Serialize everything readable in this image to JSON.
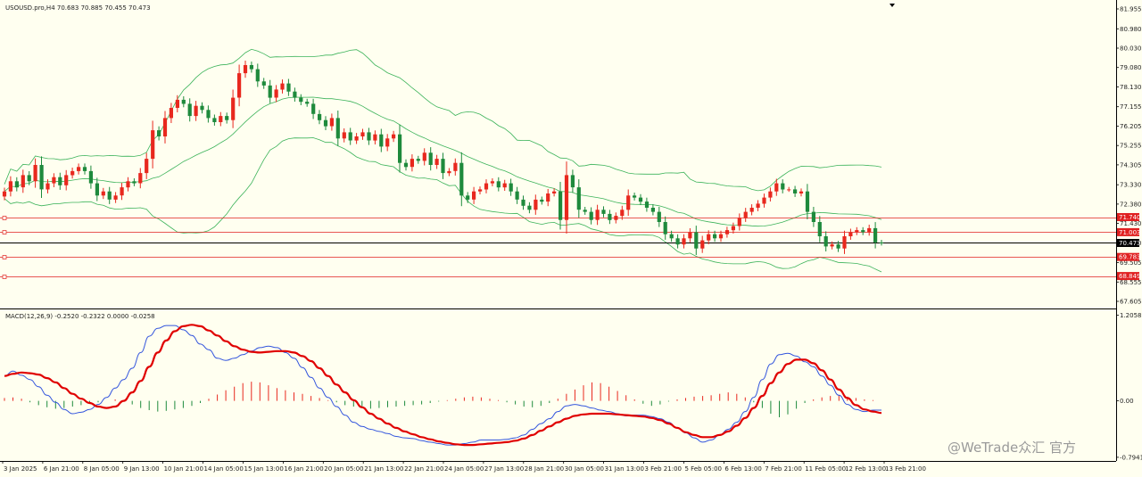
{
  "header": {
    "symbol_info": "USOUSD.pro,H4  70.683 70.885 70.455 70.473",
    "macd_info": "MACD(12,26,9) -0.2520 -0.2322 0.0000 -0.0258"
  },
  "watermark": "@WeTrade众汇 官方",
  "colors": {
    "background": "#fffff0",
    "bull": "#e8281e",
    "bear": "#1e8a3c",
    "bands": "#3cb35a",
    "macd_line": "#3355dd",
    "signal_line": "#e00000",
    "hline": "#e02020",
    "current_price": "#000000"
  },
  "chart_data": [
    {
      "type": "candlestick",
      "name": "price",
      "title": "USOUSD.pro,H4",
      "ylim": [
        67.3,
        82.0
      ],
      "y_ticks": [
        "81.955",
        "80.980",
        "80.030",
        "79.080",
        "78.130",
        "77.155",
        "76.205",
        "75.255",
        "74.305",
        "73.330",
        "72.380",
        "71.430",
        "70.480",
        "69.505",
        "68.555",
        "67.605"
      ],
      "x_ticks": [
        "3 Jan 2025",
        "6 Jan 21:00",
        "8 Jan 05:00",
        "9 Jan 13:00",
        "10 Jan 21:00",
        "14 Jan 05:00",
        "15 Jan 13:00",
        "16 Jan 21:00",
        "20 Jan 05:00",
        "21 Jan 13:00",
        "22 Jan 21:00",
        "24 Jan 05:00",
        "27 Jan 13:00",
        "28 Jan 21:00",
        "30 Jan 05:00",
        "31 Jan 13:00",
        "3 Feb 21:00",
        "5 Feb 05:00",
        "6 Feb 13:00",
        "7 Feb 21:00",
        "11 Feb 05:00",
        "12 Feb 13:00",
        "13 Feb 21:00"
      ],
      "close": [
        73.0,
        73.5,
        73.2,
        73.8,
        73.5,
        74.3,
        73.1,
        73.4,
        73.7,
        73.3,
        73.8,
        74.0,
        74.2,
        74.0,
        73.4,
        72.8,
        73.0,
        72.6,
        72.8,
        73.2,
        73.5,
        73.4,
        73.9,
        74.6,
        76.0,
        75.7,
        76.6,
        77.1,
        77.5,
        77.3,
        76.7,
        77.2,
        77.0,
        76.6,
        76.4,
        76.7,
        76.5,
        77.6,
        78.8,
        79.2,
        79.0,
        78.4,
        78.2,
        77.6,
        78.0,
        78.3,
        77.9,
        77.6,
        77.4,
        77.3,
        76.8,
        76.5,
        76.2,
        76.6,
        75.6,
        75.9,
        75.5,
        75.7,
        75.9,
        75.5,
        75.8,
        75.2,
        75.6,
        75.8,
        74.4,
        74.2,
        74.6,
        74.5,
        74.9,
        74.3,
        74.6,
        73.9,
        74.0,
        74.4,
        72.8,
        72.6,
        73.0,
        73.1,
        73.4,
        73.5,
        73.2,
        73.4,
        73.0,
        72.6,
        72.3,
        72.1,
        72.6,
        72.5,
        72.9,
        73.0,
        71.6,
        73.8,
        73.2,
        72.1,
        72.0,
        71.6,
        72.1,
        71.9,
        71.6,
        71.8,
        72.1,
        72.8,
        72.7,
        72.5,
        72.2,
        72.0,
        71.5,
        70.9,
        70.7,
        70.4,
        70.7,
        71.0,
        70.2,
        70.6,
        70.9,
        70.7,
        70.9,
        71.1,
        71.3,
        71.7,
        72.0,
        72.2,
        72.4,
        72.7,
        73.0,
        73.4,
        73.1,
        73.1,
        72.9,
        73.0,
        72.0,
        71.5,
        70.8,
        70.3,
        70.4,
        70.2,
        70.8,
        71.0,
        71.1,
        71.0,
        71.2,
        70.5,
        70.473
      ],
      "annotations": [
        {
          "text": "71.740",
          "value": 71.74
        },
        {
          "text": "71.003",
          "value": 71.003
        },
        {
          "text": "70.473",
          "value": 70.473
        },
        {
          "text": "69.783",
          "value": 69.783
        },
        {
          "text": "68.849",
          "value": 68.849
        }
      ]
    },
    {
      "type": "line",
      "name": "MACD",
      "title": "MACD(12,26,9)",
      "ylim": [
        -0.82,
        1.25
      ],
      "y_ticks": [
        "1.2058",
        "0.00",
        "-0.7941"
      ],
      "series": [
        {
          "name": "MACD",
          "values": [
            0.35,
            0.42,
            0.36,
            0.3,
            0.2,
            0.08,
            -0.02,
            -0.12,
            -0.18,
            -0.16,
            -0.12,
            -0.05,
            0.05,
            0.18,
            0.3,
            0.46,
            0.68,
            0.91,
            1.02,
            1.06,
            1.06,
            1.0,
            0.92,
            0.8,
            0.72,
            0.6,
            0.57,
            0.6,
            0.65,
            0.7,
            0.75,
            0.77,
            0.75,
            0.68,
            0.6,
            0.47,
            0.33,
            0.18,
            0.05,
            -0.08,
            -0.2,
            -0.3,
            -0.36,
            -0.4,
            -0.43,
            -0.46,
            -0.5,
            -0.52,
            -0.53,
            -0.56,
            -0.58,
            -0.6,
            -0.62,
            -0.62,
            -0.6,
            -0.58,
            -0.55,
            -0.55,
            -0.55,
            -0.54,
            -0.52,
            -0.48,
            -0.4,
            -0.32,
            -0.25,
            -0.15,
            -0.07,
            -0.05,
            -0.07,
            -0.1,
            -0.13,
            -0.15,
            -0.18,
            -0.21,
            -0.2,
            -0.2,
            -0.22,
            -0.25,
            -0.3,
            -0.38,
            -0.45,
            -0.52,
            -0.58,
            -0.55,
            -0.48,
            -0.4,
            -0.3,
            -0.15,
            0.05,
            0.3,
            0.52,
            0.65,
            0.67,
            0.63,
            0.55,
            0.48,
            0.35,
            0.22,
            0.08,
            -0.05,
            -0.12,
            -0.15,
            -0.13,
            -0.13
          ]
        },
        {
          "name": "Signal",
          "values": [
            0.35,
            0.38,
            0.4,
            0.39,
            0.37,
            0.32,
            0.26,
            0.18,
            0.1,
            0.03,
            -0.03,
            -0.08,
            -0.1,
            -0.08,
            0.0,
            0.12,
            0.28,
            0.48,
            0.68,
            0.85,
            0.98,
            1.05,
            1.07,
            1.05,
            0.99,
            0.92,
            0.84,
            0.77,
            0.72,
            0.69,
            0.68,
            0.69,
            0.7,
            0.7,
            0.68,
            0.63,
            0.56,
            0.46,
            0.35,
            0.23,
            0.12,
            0.01,
            -0.09,
            -0.18,
            -0.25,
            -0.32,
            -0.38,
            -0.43,
            -0.47,
            -0.51,
            -0.54,
            -0.57,
            -0.59,
            -0.61,
            -0.62,
            -0.62,
            -0.61,
            -0.6,
            -0.59,
            -0.58,
            -0.56,
            -0.53,
            -0.48,
            -0.42,
            -0.36,
            -0.3,
            -0.25,
            -0.21,
            -0.19,
            -0.18,
            -0.18,
            -0.18,
            -0.19,
            -0.2,
            -0.21,
            -0.22,
            -0.24,
            -0.27,
            -0.32,
            -0.38,
            -0.44,
            -0.48,
            -0.51,
            -0.51,
            -0.48,
            -0.43,
            -0.35,
            -0.24,
            -0.1,
            0.07,
            0.25,
            0.4,
            0.52,
            0.58,
            0.58,
            0.53,
            0.43,
            0.3,
            0.16,
            0.04,
            -0.06,
            -0.12,
            -0.15,
            -0.17
          ]
        },
        {
          "name": "Histogram",
          "values": [
            0.04,
            0.05,
            0.03,
            -0.02,
            -0.06,
            -0.09,
            -0.11,
            -0.1,
            -0.08,
            -0.06,
            -0.04,
            -0.02,
            0.0,
            0.02,
            -0.01,
            -0.05,
            -0.1,
            -0.13,
            -0.15,
            -0.14,
            -0.12,
            -0.1,
            -0.07,
            -0.03,
            0.03,
            0.09,
            0.15,
            0.2,
            0.25,
            0.27,
            0.26,
            0.22,
            0.18,
            0.15,
            0.12,
            0.1,
            0.07,
            0.04,
            0.01,
            -0.02,
            -0.06,
            -0.08,
            -0.1,
            -0.11,
            -0.1,
            -0.09,
            -0.08,
            -0.07,
            -0.06,
            -0.05,
            -0.03,
            -0.01,
            0.01,
            0.03,
            0.05,
            0.06,
            0.05,
            0.03,
            0.01,
            -0.02,
            -0.05,
            -0.08,
            -0.09,
            -0.07,
            -0.03,
            0.03,
            0.1,
            0.16,
            0.22,
            0.26,
            0.25,
            0.2,
            0.14,
            0.08,
            0.02,
            -0.04,
            -0.07,
            -0.05,
            -0.01,
            0.02,
            0.04,
            0.06,
            0.07,
            0.08,
            0.1,
            0.12,
            0.1,
            0.05,
            -0.02,
            -0.1,
            -0.18,
            -0.23,
            -0.19,
            -0.11,
            -0.03,
            0.02,
            0.05,
            0.07,
            0.08,
            0.06,
            0.04,
            0.02,
            0.01,
            0.0
          ]
        }
      ]
    }
  ]
}
